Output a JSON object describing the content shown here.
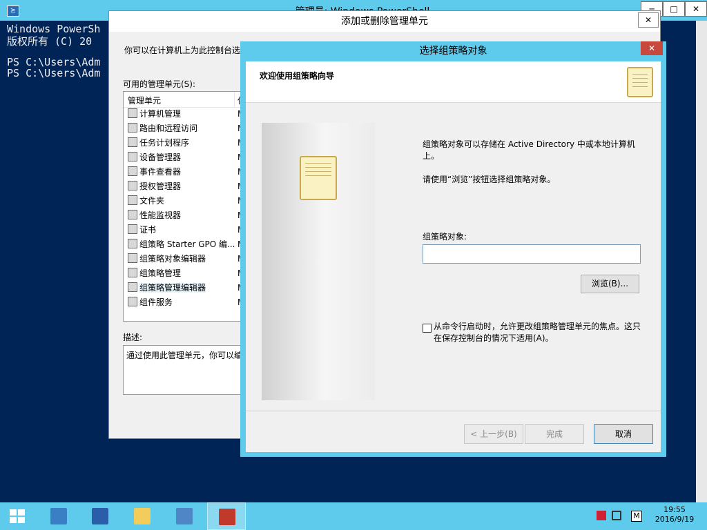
{
  "powershell": {
    "title": "管理员: Windows PowerShell",
    "icon": "powershell-icon",
    "lines": [
      "Windows PowerSh",
      "版权所有 (C) 20",
      "",
      "PS C:\\Users\\Adm",
      "PS C:\\Users\\Adm"
    ],
    "minimize": "─",
    "maximize": "□",
    "close": "✕"
  },
  "add_snapin_dialog": {
    "title": "添加或删除管理单元",
    "close": "✕",
    "description": "你可以在计算机上为此控制台选",
    "available_label": "可用的管理单元(S):",
    "columns": [
      "管理单元",
      "供"
    ],
    "items": [
      {
        "label": "计算机管理",
        "icon": "computer-management-icon",
        "vendor": "M"
      },
      {
        "label": "路由和远程访问",
        "icon": "routing-icon",
        "vendor": "M"
      },
      {
        "label": "任务计划程序",
        "icon": "clock-icon",
        "vendor": "M"
      },
      {
        "label": "设备管理器",
        "icon": "device-manager-icon",
        "vendor": "M"
      },
      {
        "label": "事件查看器",
        "icon": "event-viewer-icon",
        "vendor": "M"
      },
      {
        "label": "授权管理器",
        "icon": "authorization-icon",
        "vendor": "M"
      },
      {
        "label": "文件夹",
        "icon": "folder-icon",
        "vendor": "M"
      },
      {
        "label": "性能监视器",
        "icon": "performance-icon",
        "vendor": "M"
      },
      {
        "label": "证书",
        "icon": "certificate-icon",
        "vendor": "M"
      },
      {
        "label": "组策略 Starter GPO 编...",
        "icon": "gpo-icon",
        "vendor": "M"
      },
      {
        "label": "组策略对象编辑器",
        "icon": "gpo-icon",
        "vendor": "M"
      },
      {
        "label": "组策略管理",
        "icon": "gpo-icon",
        "vendor": "M"
      },
      {
        "label": "组策略管理编辑器",
        "icon": "gpo-icon",
        "vendor": "M"
      },
      {
        "label": "组件服务",
        "icon": "component-services-icon",
        "vendor": "M"
      }
    ],
    "selected_index": 12,
    "desc_label": "描述:",
    "desc_text": "通过使用此管理单元，你可以编"
  },
  "gpo_wizard": {
    "title": "选择组策略对象",
    "close": "✕",
    "heading": "欢迎使用组策略向导",
    "text1": "组策略对象可以存储在 Active Directory 中或本地计算机上。",
    "text2": "请使用“浏览”按钮选择组策略对象。",
    "field_label": "组策略对象:",
    "field_value": "",
    "browse": "浏览(B)...",
    "checkbox_label": "从命令行启动时，允许更改组策略管理单元的焦点。这只在保存控制台的情况下适用(A)。",
    "checkbox_checked": false,
    "back": "< 上一步(B)",
    "finish": "完成",
    "cancel": "取消"
  },
  "taskbar": {
    "items": [
      "start-icon",
      "server-manager-icon",
      "powershell-icon",
      "file-explorer-icon",
      "control-panel-icon",
      "toolbox-icon"
    ],
    "active_index": 5,
    "time": "19:55",
    "date": "2016/9/19",
    "lang": "M"
  },
  "colors": {
    "accent": "#5ecbec",
    "console_bg": "#012456",
    "close_red": "#c7483d"
  }
}
